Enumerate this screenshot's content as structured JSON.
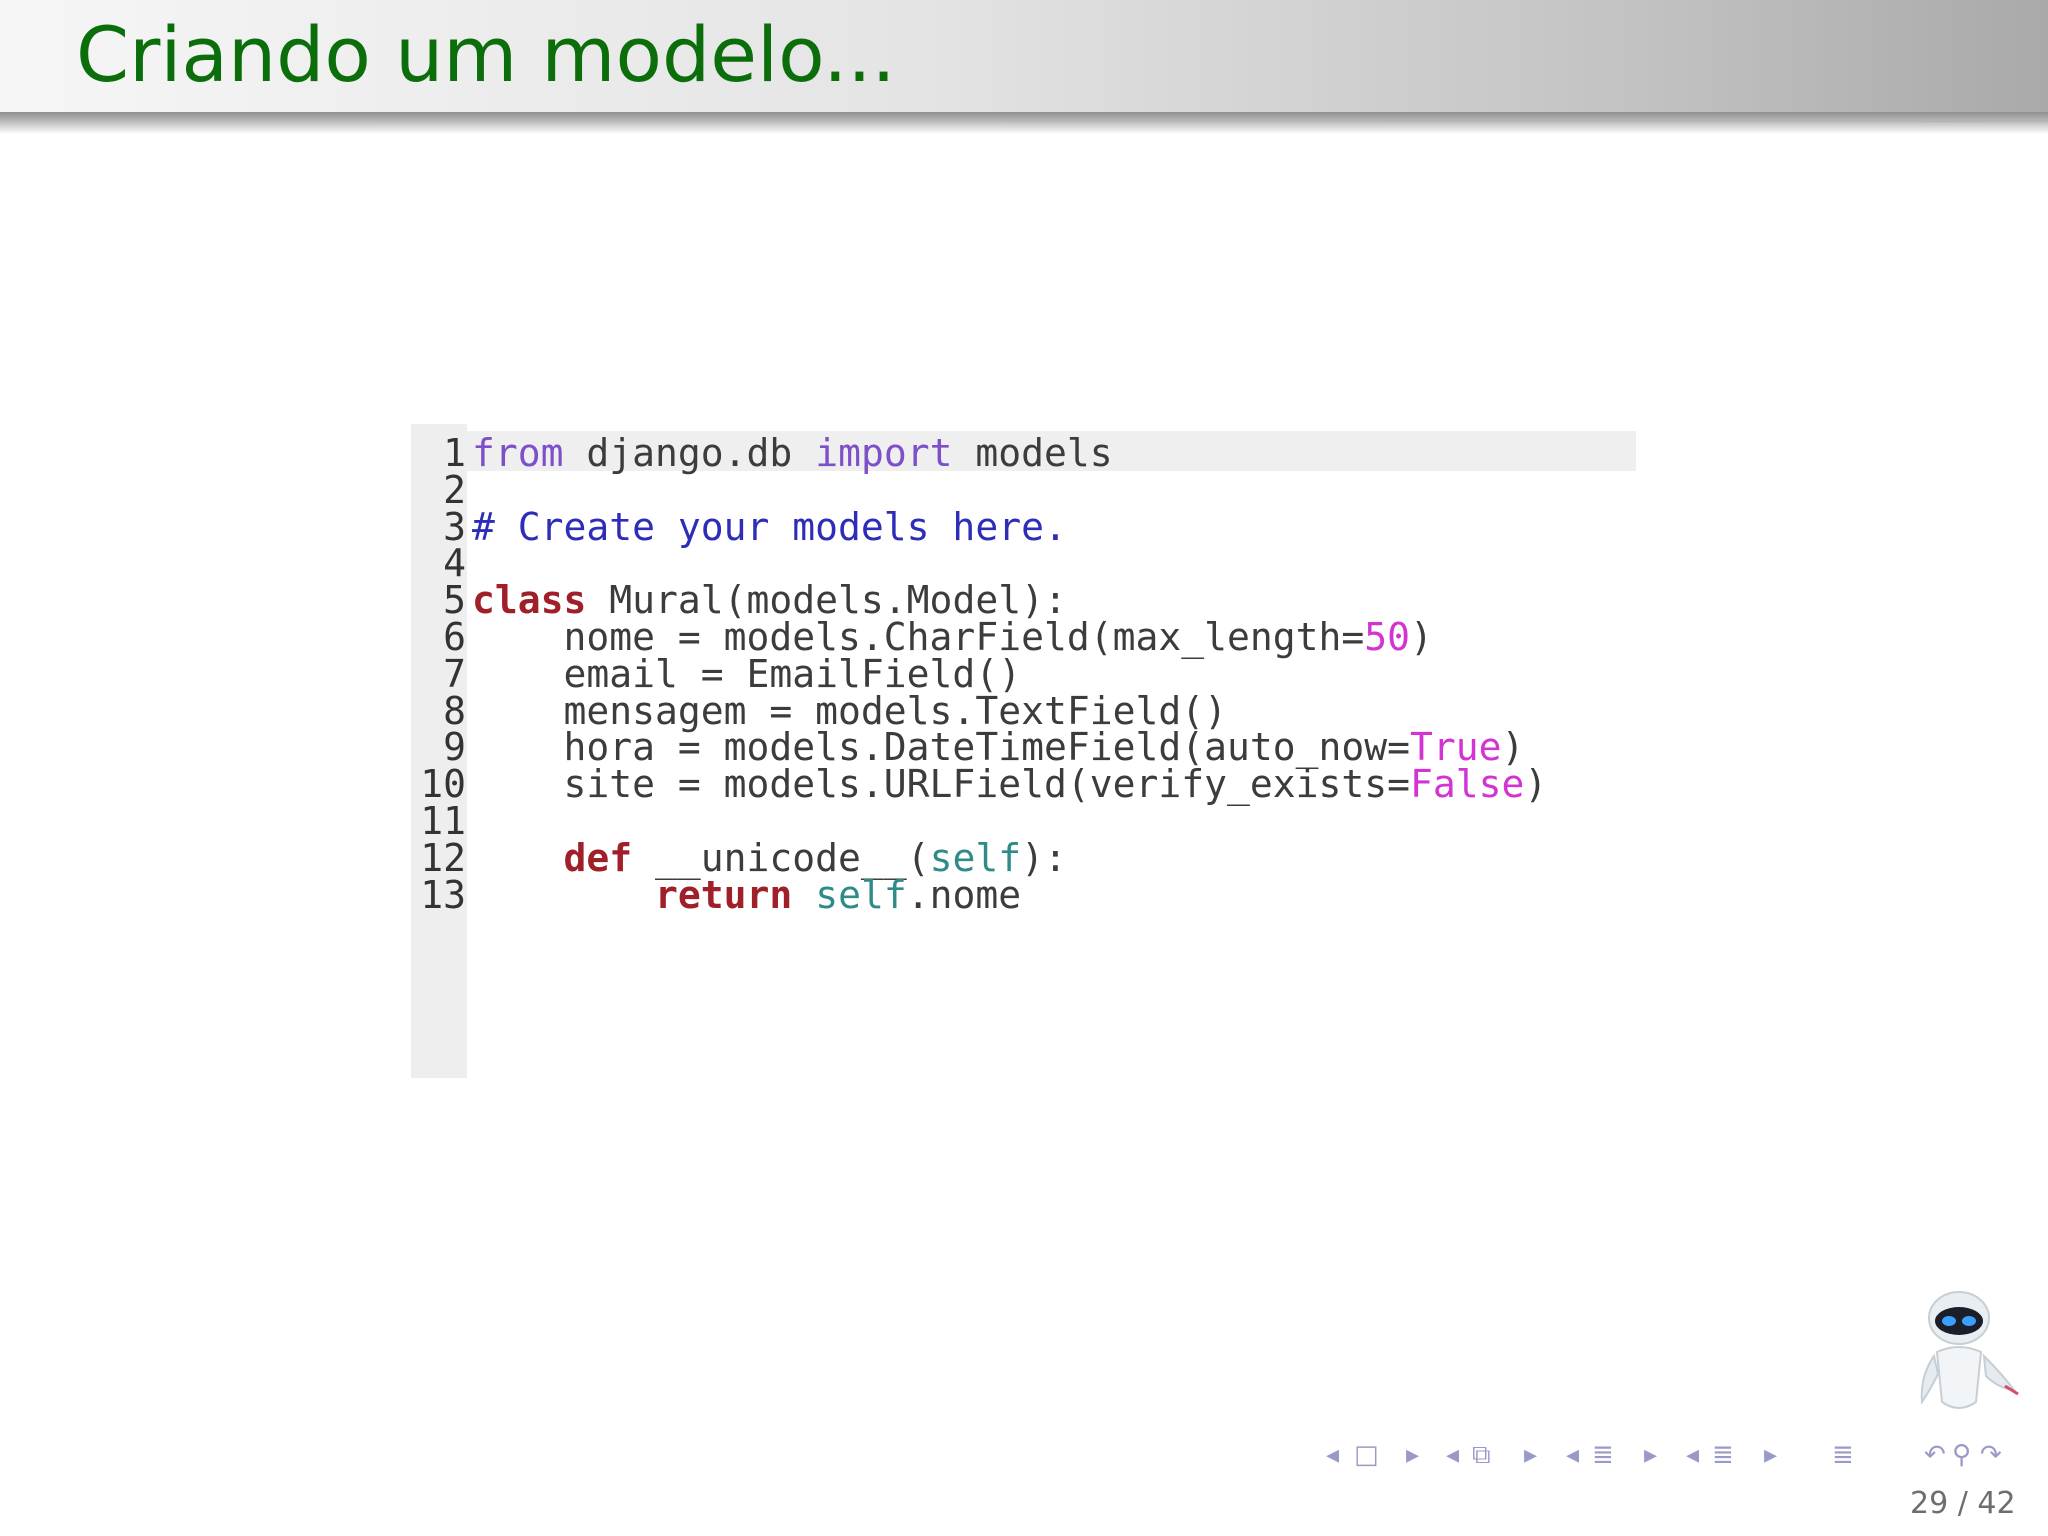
{
  "slide": {
    "title": "Criando um modelo...",
    "page_current": "29",
    "page_total": "42",
    "page_label": "29 / 42"
  },
  "code": {
    "language": "python",
    "lines": [
      {
        "n": "1",
        "tokens": [
          {
            "t": "from",
            "c": "kw-purple"
          },
          {
            "t": " django.db ",
            "c": ""
          },
          {
            "t": "import",
            "c": "kw-purple"
          },
          {
            "t": " models",
            "c": ""
          }
        ]
      },
      {
        "n": "2",
        "tokens": []
      },
      {
        "n": "3",
        "tokens": [
          {
            "t": "# Create your models here.",
            "c": "comment"
          }
        ]
      },
      {
        "n": "4",
        "tokens": []
      },
      {
        "n": "5",
        "tokens": [
          {
            "t": "class",
            "c": "kw-red"
          },
          {
            "t": " Mural(models.Model):",
            "c": ""
          }
        ]
      },
      {
        "n": "6",
        "tokens": [
          {
            "t": "    nome = models.CharField(max_length=",
            "c": ""
          },
          {
            "t": "50",
            "c": "num-lit"
          },
          {
            "t": ")",
            "c": ""
          }
        ]
      },
      {
        "n": "7",
        "tokens": [
          {
            "t": "    email = EmailField()",
            "c": ""
          }
        ]
      },
      {
        "n": "8",
        "tokens": [
          {
            "t": "    mensagem = models.TextField()",
            "c": ""
          }
        ]
      },
      {
        "n": "9",
        "tokens": [
          {
            "t": "    hora = models.DateTimeField(auto_now=",
            "c": ""
          },
          {
            "t": "True",
            "c": "num-lit"
          },
          {
            "t": ")",
            "c": ""
          }
        ]
      },
      {
        "n": "10",
        "tokens": [
          {
            "t": "    site = models.URLField(verify_exists=",
            "c": ""
          },
          {
            "t": "False",
            "c": "num-lit"
          },
          {
            "t": ")",
            "c": ""
          }
        ]
      },
      {
        "n": "11",
        "tokens": []
      },
      {
        "n": "12",
        "tokens": [
          {
            "t": "    ",
            "c": ""
          },
          {
            "t": "def",
            "c": "kw-red"
          },
          {
            "t": " __unicode__(",
            "c": ""
          },
          {
            "t": "self",
            "c": "builtin"
          },
          {
            "t": "):",
            "c": ""
          }
        ]
      },
      {
        "n": "13",
        "tokens": [
          {
            "t": "        ",
            "c": ""
          },
          {
            "t": "return",
            "c": "kw-red"
          },
          {
            "t": " ",
            "c": ""
          },
          {
            "t": "self",
            "c": "builtin"
          },
          {
            "t": ".nome",
            "c": ""
          }
        ]
      }
    ]
  },
  "navigation": {
    "icons": [
      "nav-prev-arrow-icon",
      "frame-icon",
      "nav-next-arrow-icon",
      "nav-prev-arrow-icon",
      "subsection-icon",
      "nav-next-arrow-icon",
      "nav-prev-arrow-icon",
      "section-icon",
      "nav-next-arrow-icon",
      "nav-prev-arrow-icon",
      "toc-icon",
      "nav-next-arrow-icon",
      "outline-icon",
      "back-icon",
      "search-icon",
      "forward-icon"
    ]
  },
  "colors": {
    "title": "#0b6e0b",
    "keyword_purple": "#7d4fc9",
    "comment_blue": "#2d2db8",
    "keyword_red": "#a0202a",
    "literal_magenta": "#d233d2",
    "builtin_teal": "#2e8b87",
    "nav_icons": "#9a9ac8"
  }
}
